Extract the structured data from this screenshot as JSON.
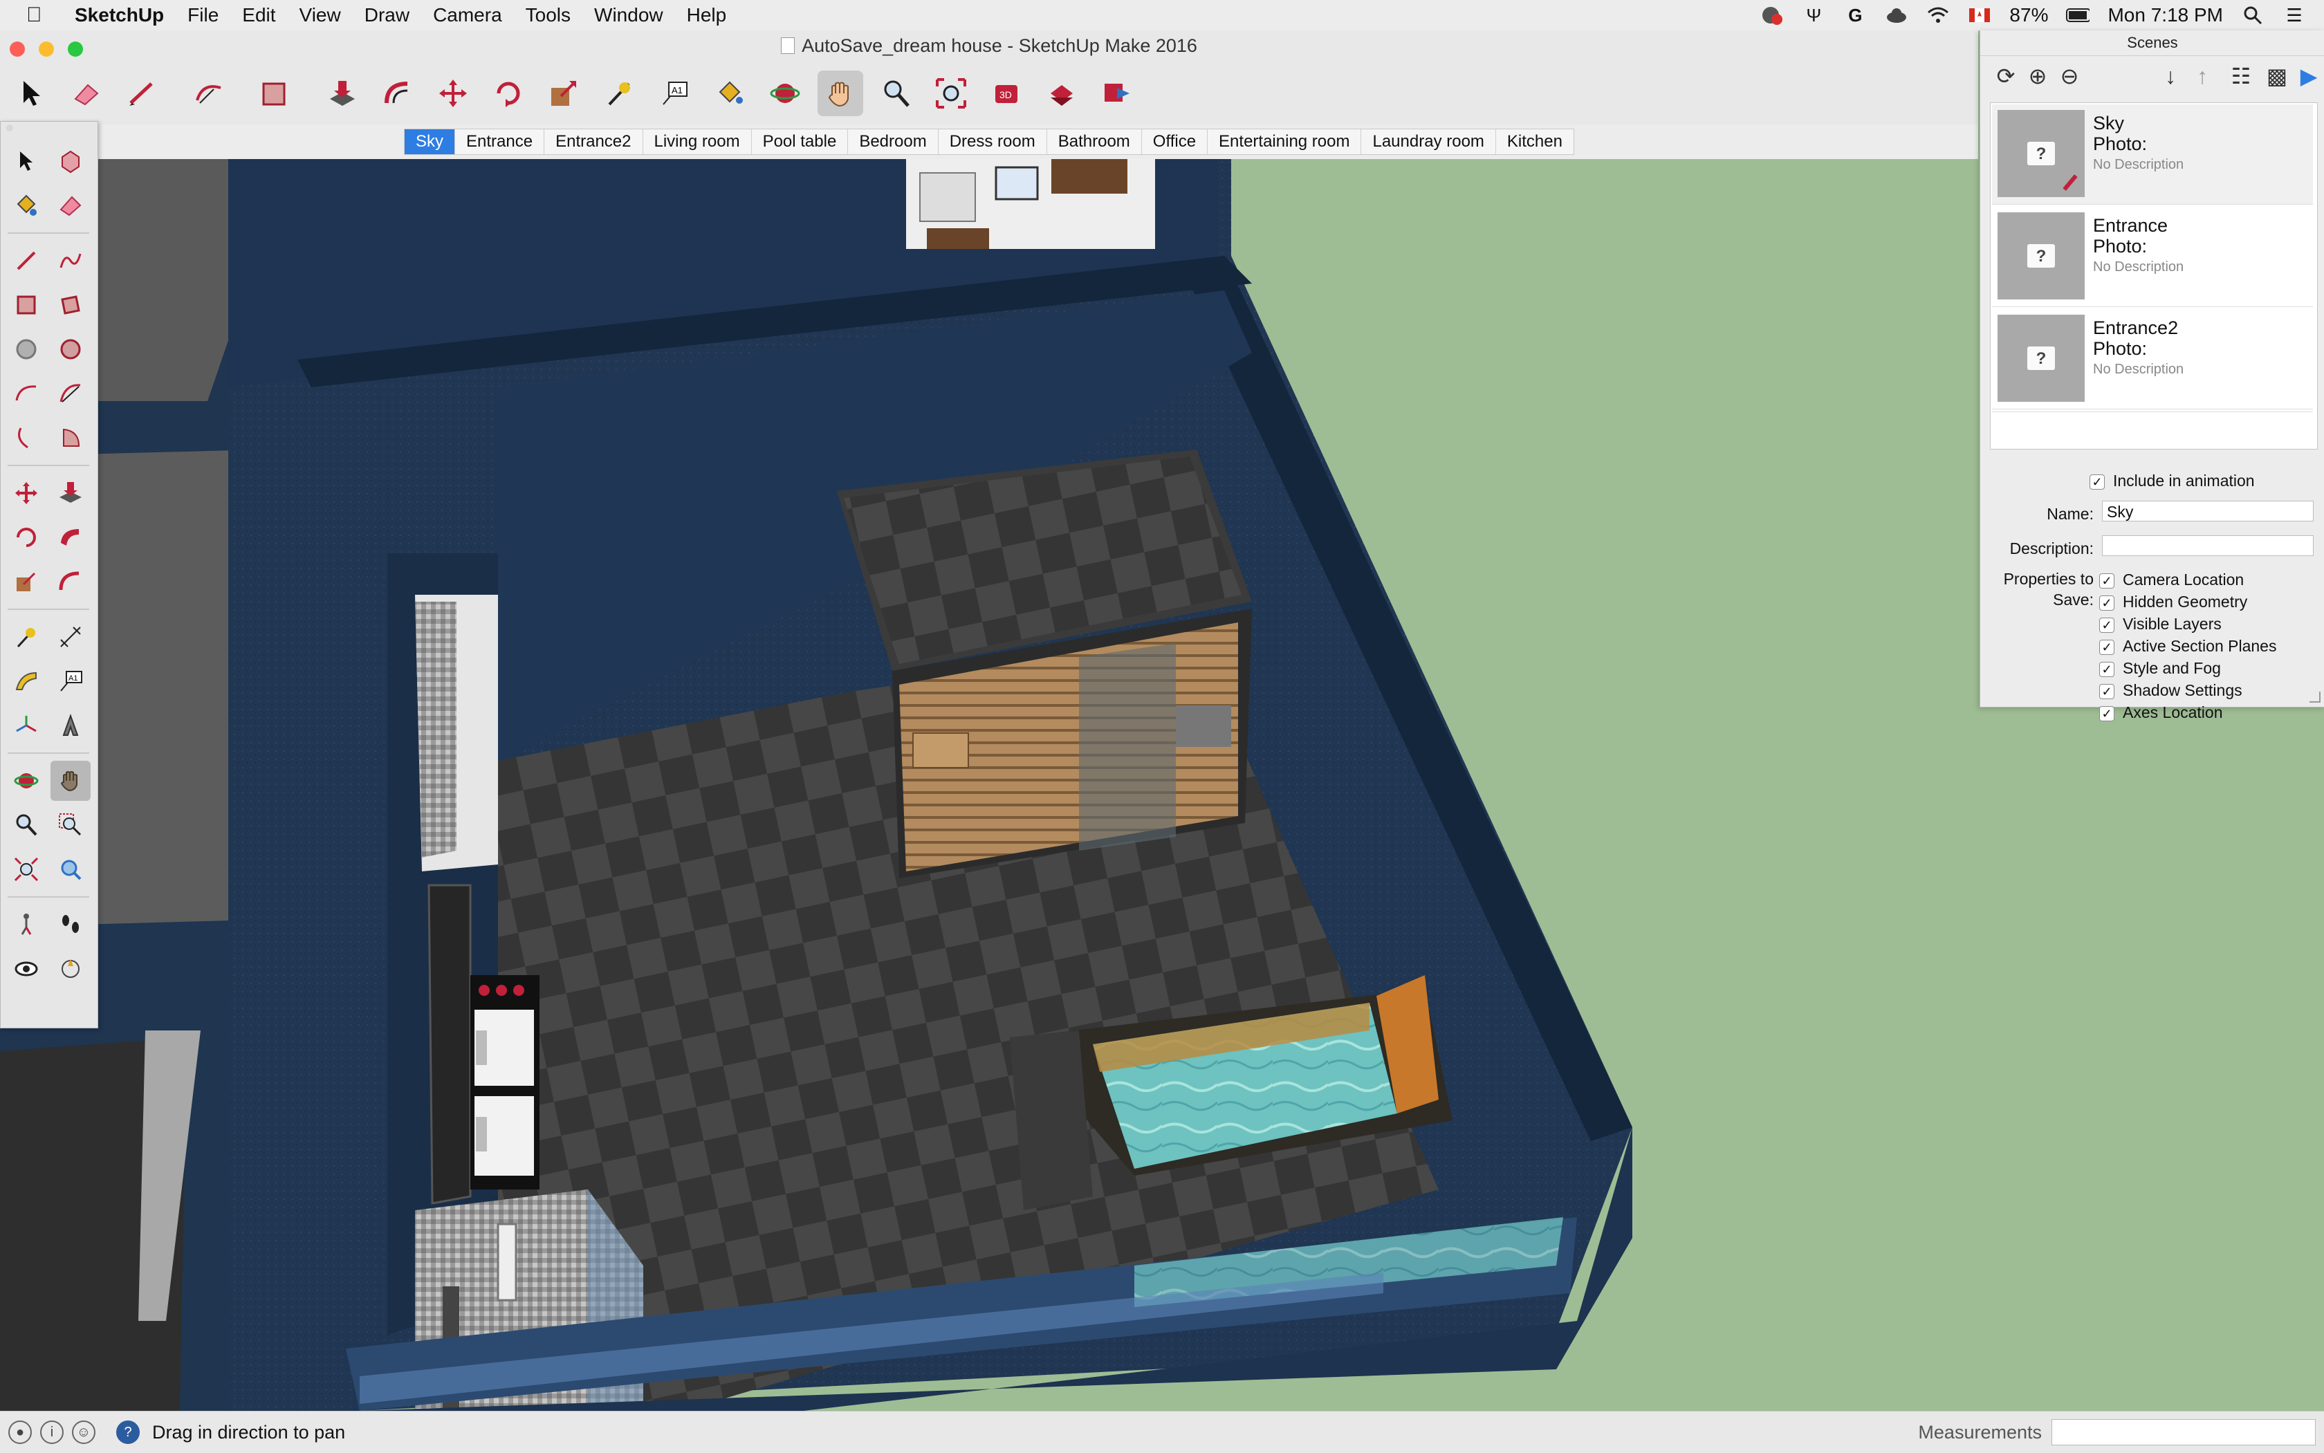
{
  "menubar": {
    "app_name": "SketchUp",
    "menus": [
      "File",
      "Edit",
      "View",
      "Draw",
      "Camera",
      "Tools",
      "Window",
      "Help"
    ],
    "battery": "87%",
    "clock": "Mon 7:18 PM"
  },
  "window": {
    "title": "AutoSave_dream house - SketchUp Make 2016"
  },
  "scene_tabs": [
    {
      "label": "Sky",
      "selected": true
    },
    {
      "label": "Entrance",
      "selected": false
    },
    {
      "label": "Entrance2",
      "selected": false
    },
    {
      "label": "Living room",
      "selected": false
    },
    {
      "label": "Pool table",
      "selected": false
    },
    {
      "label": "Bedroom",
      "selected": false
    },
    {
      "label": "Dress room",
      "selected": false
    },
    {
      "label": "Bathroom",
      "selected": false
    },
    {
      "label": "Office",
      "selected": false
    },
    {
      "label": "Entertaining room",
      "selected": false
    },
    {
      "label": "Laundray room",
      "selected": false
    },
    {
      "label": "Kitchen",
      "selected": false
    }
  ],
  "scenes_panel": {
    "title": "Scenes",
    "scenes": [
      {
        "name": "Sky",
        "photo_label": "Photo:",
        "description": "No Description"
      },
      {
        "name": "Entrance",
        "photo_label": "Photo:",
        "description": "No Description"
      },
      {
        "name": "Entrance2",
        "photo_label": "Photo:",
        "description": "No Description"
      }
    ],
    "include_in_animation_label": "Include in animation",
    "name_label": "Name:",
    "name_value": "Sky",
    "description_label": "Description:",
    "description_value": "",
    "properties_label_1": "Properties to",
    "properties_label_2": "Save:",
    "properties": [
      {
        "label": "Camera Location",
        "checked": true
      },
      {
        "label": "Hidden Geometry",
        "checked": true
      },
      {
        "label": "Visible Layers",
        "checked": true
      },
      {
        "label": "Active Section Planes",
        "checked": true
      },
      {
        "label": "Style and Fog",
        "checked": true
      },
      {
        "label": "Shadow Settings",
        "checked": true
      },
      {
        "label": "Axes Location",
        "checked": true
      }
    ]
  },
  "statusbar": {
    "message": "Drag in direction to pan",
    "measurements_label": "Measurements",
    "measurements_value": ""
  },
  "colors": {
    "selected_tab": "#2d7de3",
    "ground": "#9fbd94",
    "walls": "#1f3550",
    "floor": "#3e3e3e",
    "pool_water": "#6fc3c1"
  }
}
